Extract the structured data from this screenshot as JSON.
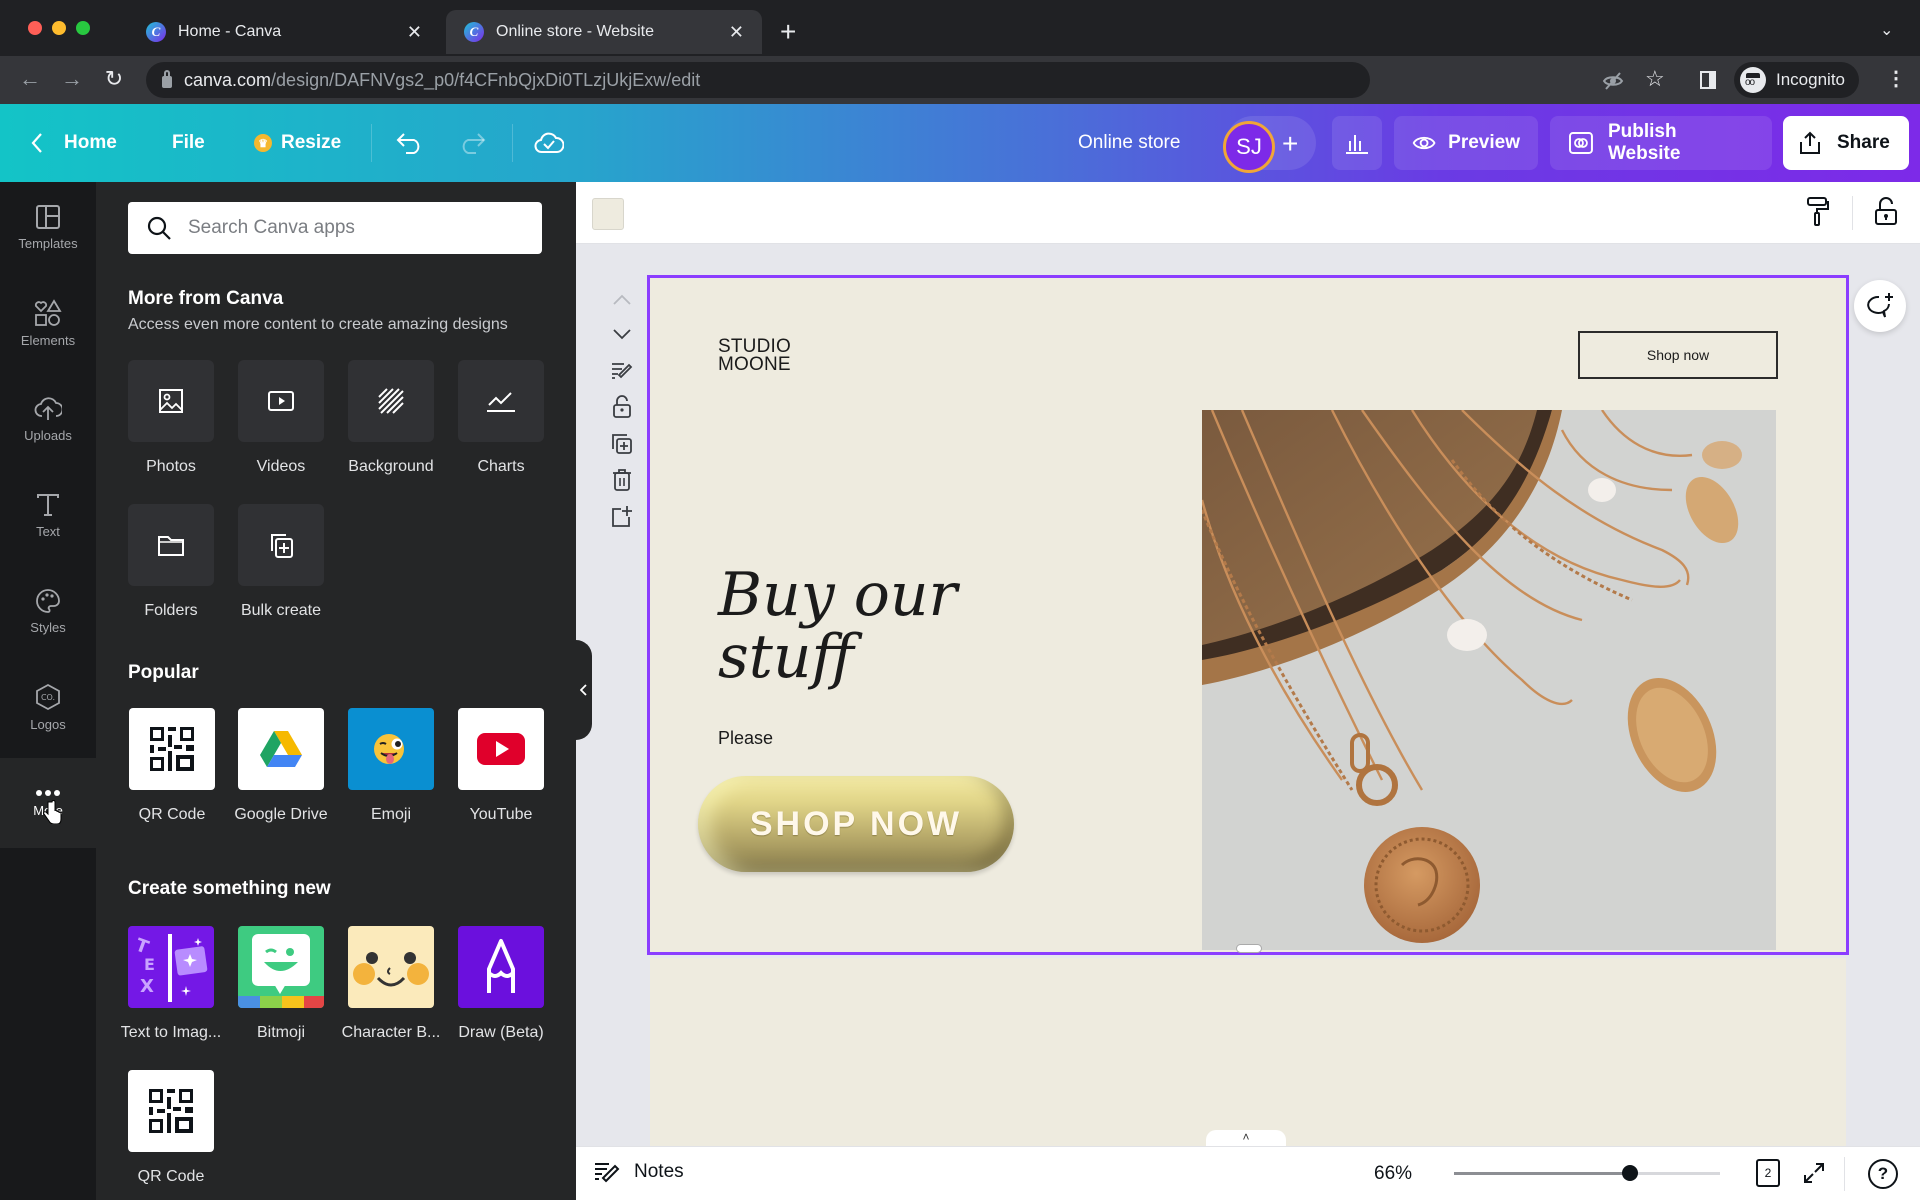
{
  "browser": {
    "tabs": [
      {
        "title": "Home - Canva",
        "active": false
      },
      {
        "title": "Online store - Website",
        "active": true
      }
    ],
    "url_host": "canva.com",
    "url_path": "/design/DAFNVgs2_p0/f4CFnbQjxDi0TLzjUkjExw/edit",
    "profile_label": "Incognito"
  },
  "header": {
    "home_label": "Home",
    "file_label": "File",
    "resize_label": "Resize",
    "design_title": "Online store",
    "avatar_initials": "SJ",
    "preview_label": "Preview",
    "publish_label": "Publish Website",
    "share_label": "Share"
  },
  "rail": {
    "items": [
      {
        "label": "Templates",
        "icon": "templates-icon"
      },
      {
        "label": "Elements",
        "icon": "elements-icon"
      },
      {
        "label": "Uploads",
        "icon": "uploads-icon"
      },
      {
        "label": "Text",
        "icon": "text-icon"
      },
      {
        "label": "Styles",
        "icon": "styles-icon"
      },
      {
        "label": "Logos",
        "icon": "logos-icon"
      },
      {
        "label": "More",
        "icon": "more-icon",
        "active": true
      }
    ]
  },
  "panel": {
    "search_placeholder": "Search Canva apps",
    "more_title": "More from Canva",
    "more_subtitle": "Access even more content to create amazing designs",
    "more_items": [
      "Photos",
      "Videos",
      "Background",
      "Charts",
      "Folders",
      "Bulk create"
    ],
    "popular_title": "Popular",
    "popular_items": [
      "QR Code",
      "Google Drive",
      "Emoji",
      "YouTube"
    ],
    "create_title": "Create something new",
    "create_items": [
      "Text to Imag...",
      "Bitmoji",
      "Character B...",
      "Draw (Beta)",
      "QR Code"
    ]
  },
  "canvas": {
    "brand_line1": "STUDIO",
    "brand_line2": "MOONE",
    "nav_button": "Shop now",
    "headline_line1": "Buy our",
    "headline_line2": "stuff",
    "body_text": "Please",
    "cta_label": "SHOP NOW",
    "background_color": "#eeebdf",
    "selection_color": "#8b3dff"
  },
  "footer": {
    "notes_label": "Notes",
    "zoom_percent": "66%",
    "zoom_slider_fraction": 0.66,
    "page_count": "2"
  }
}
